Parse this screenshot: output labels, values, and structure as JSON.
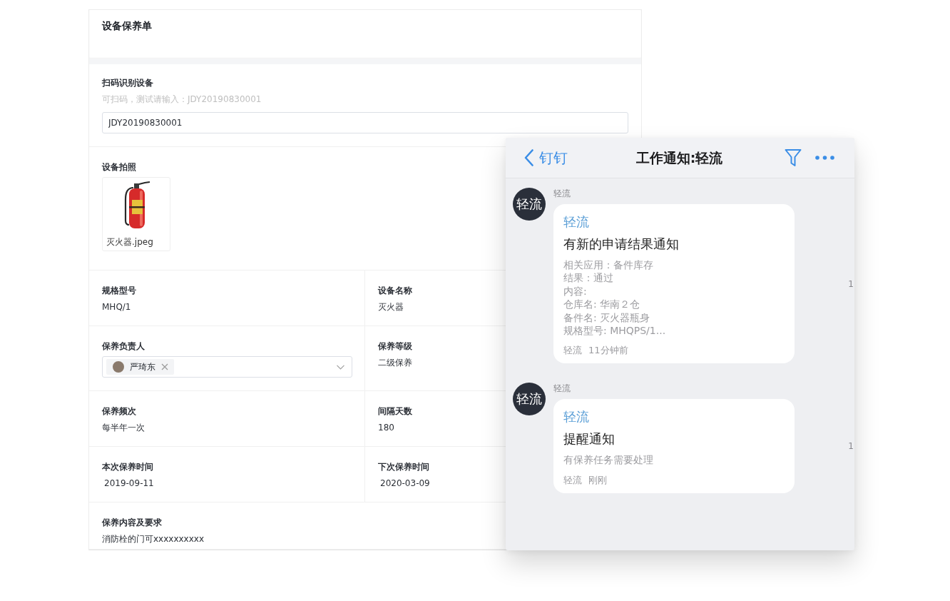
{
  "form": {
    "title": "设备保养单",
    "scan": {
      "label": "扫码识别设备",
      "hint": "可扫码，测试请输入：JDY20190830001",
      "value": "JDY20190830001"
    },
    "photo": {
      "label": "设备拍照",
      "file_name": "灭火器.jpeg"
    },
    "rows": [
      {
        "cells": [
          {
            "kind": "text",
            "label": "规格型号",
            "value": "MHQ/1"
          },
          {
            "kind": "text",
            "label": "设备名称",
            "value": "灭火器"
          }
        ]
      },
      {
        "cells": [
          {
            "kind": "select",
            "label": "保养负责人",
            "chips": [
              {
                "name": "严琦东"
              }
            ]
          },
          {
            "kind": "text",
            "label": "保养等级",
            "value": "二级保养"
          }
        ]
      },
      {
        "cells": [
          {
            "kind": "text",
            "label": "保养频次",
            "value": "每半年一次"
          },
          {
            "kind": "text",
            "label": "间隔天数",
            "value": "180"
          }
        ]
      },
      {
        "cells": [
          {
            "kind": "date",
            "label": "本次保养时间",
            "value": "2019-09-11"
          },
          {
            "kind": "date",
            "label": "下次保养时间",
            "value": "2020-03-09"
          }
        ]
      }
    ],
    "notes": {
      "label": "保养内容及要求",
      "value": "消防栓的门可xxxxxxxxxx"
    }
  },
  "notification_panel": {
    "back_label": "钉钉",
    "title": "工作通知:轻流",
    "messages": [
      {
        "avatar_text": "轻流",
        "sender": "轻流",
        "app": "轻流",
        "title": "有新的申请结果通知",
        "lines": [
          "相关应用：备件库存",
          "结果：通过",
          "内容:",
          "仓库名: 华南２仓",
          "备件名: 灭火器瓶身",
          "规格型号: MHQPS/1..."
        ],
        "footer_source": "轻流",
        "footer_time": "11分钟前",
        "side_text": "1"
      },
      {
        "avatar_text": "轻流",
        "sender": "轻流",
        "app": "轻流",
        "title": "提醒通知",
        "lines": [
          "有保养任务需要处理"
        ],
        "footer_source": "轻流",
        "footer_time": "刚刚",
        "side_text": "1"
      }
    ]
  }
}
